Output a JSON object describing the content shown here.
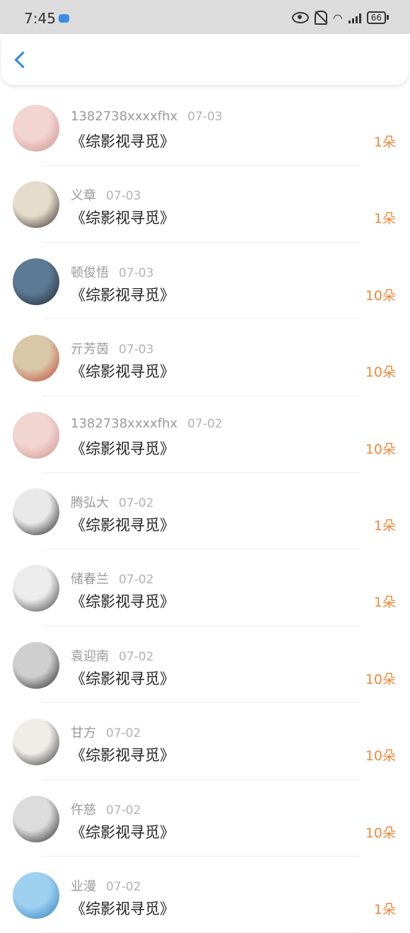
{
  "status_bar": {
    "time": "7:45",
    "battery": "66",
    "network": "4G"
  },
  "nav": {
    "back_icon": "chevron-left-icon"
  },
  "items": [
    {
      "name": "1382738xxxxfhx",
      "date": "07-03",
      "title": "《综影视寻觅》",
      "amount": "1朵",
      "avatar_colors": [
        "#f2d4d0",
        "#c98e8a"
      ]
    },
    {
      "name": "义章",
      "date": "07-03",
      "title": "《综影视寻觅》",
      "amount": "1朵",
      "avatar_colors": [
        "#e6dccc",
        "#2a2420"
      ]
    },
    {
      "name": "顿俊悟",
      "date": "07-03",
      "title": "《综影视寻觅》",
      "amount": "10朵",
      "avatar_colors": [
        "#5c7a94",
        "#1a242e"
      ]
    },
    {
      "name": "亓芳茵",
      "date": "07-03",
      "title": "《综影视寻觅》",
      "amount": "10朵",
      "avatar_colors": [
        "#d8c8a8",
        "#c23a2a"
      ]
    },
    {
      "name": "1382738xxxxfhx",
      "date": "07-02",
      "title": "《综影视寻觅》",
      "amount": "10朵",
      "avatar_colors": [
        "#f2d4d0",
        "#c98e8a"
      ]
    },
    {
      "name": "腾弘大",
      "date": "07-02",
      "title": "《综影视寻觅》",
      "amount": "1朵",
      "avatar_colors": [
        "#e8e8e8",
        "#111111"
      ]
    },
    {
      "name": "储春兰",
      "date": "07-02",
      "title": "《综影视寻觅》",
      "amount": "1朵",
      "avatar_colors": [
        "#ececec",
        "#333333"
      ]
    },
    {
      "name": "袁迎南",
      "date": "07-02",
      "title": "《综影视寻觅》",
      "amount": "10朵",
      "avatar_colors": [
        "#cfcfcf",
        "#1a1a1a"
      ]
    },
    {
      "name": "甘方",
      "date": "07-02",
      "title": "《综影视寻觅》",
      "amount": "10朵",
      "avatar_colors": [
        "#f0ece8",
        "#2a2a2a"
      ]
    },
    {
      "name": "仵慈",
      "date": "07-02",
      "title": "《综影视寻觅》",
      "amount": "10朵",
      "avatar_colors": [
        "#dcdcdc",
        "#1c1c1c"
      ]
    },
    {
      "name": "业漫",
      "date": "07-02",
      "title": "《综影视寻觅》",
      "amount": "1朵",
      "avatar_colors": [
        "#9ed0f0",
        "#2a7ac0"
      ]
    }
  ]
}
